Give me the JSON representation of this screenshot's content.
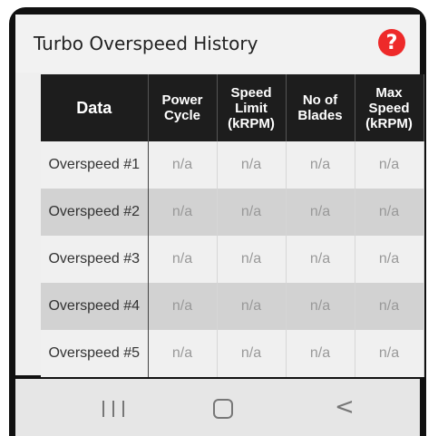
{
  "header": {
    "title": "Turbo Overspeed History",
    "help_icon": "?"
  },
  "table": {
    "columns": [
      "Data",
      "Power Cycle",
      "Speed Limit (kRPM)",
      "No of Blades",
      "Max Speed (kRPM)"
    ],
    "rows": [
      {
        "label": "Overspeed #1",
        "values": [
          "n/a",
          "n/a",
          "n/a",
          "n/a"
        ]
      },
      {
        "label": "Overspeed #2",
        "values": [
          "n/a",
          "n/a",
          "n/a",
          "n/a"
        ]
      },
      {
        "label": "Overspeed #3",
        "values": [
          "n/a",
          "n/a",
          "n/a",
          "n/a"
        ]
      },
      {
        "label": "Overspeed #4",
        "values": [
          "n/a",
          "n/a",
          "n/a",
          "n/a"
        ]
      },
      {
        "label": "Overspeed #5",
        "values": [
          "n/a",
          "n/a",
          "n/a",
          "n/a"
        ]
      }
    ]
  },
  "navbar": {
    "recents_icon": "recents-icon",
    "home_icon": "home-icon",
    "back_icon": "back-icon",
    "back_glyph": "<"
  },
  "colors": {
    "help_red": "#ee2a2a",
    "header_bg": "#1d1d1d",
    "row_alt": "#d2d2d2"
  }
}
